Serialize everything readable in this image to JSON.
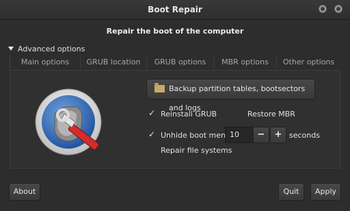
{
  "window": {
    "title": "Boot Repair"
  },
  "heading": "Repair the boot of the computer",
  "advanced": {
    "label": "Advanced options"
  },
  "tabs": [
    {
      "label": "Main options",
      "active": true
    },
    {
      "label": "GRUB location",
      "active": false
    },
    {
      "label": "GRUB options",
      "active": false
    },
    {
      "label": "MBR options",
      "active": false
    },
    {
      "label": "Other options",
      "active": false
    }
  ],
  "main": {
    "backup_button_label": "Backup partition tables, bootsectors and logs",
    "reinstall_grub": {
      "label": "Reinstall GRUB",
      "checked": true
    },
    "restore_mbr": {
      "label": "Restore MBR",
      "checked": false
    },
    "unhide_boot_menu": {
      "label": "Unhide boot menu :",
      "checked": true,
      "value": "10",
      "unit": "seconds"
    },
    "repair_fs": {
      "label": "Repair file systems",
      "checked": false
    }
  },
  "icons": {
    "check": "✓",
    "minus": "−",
    "plus": "+"
  },
  "footer": {
    "about": "About",
    "quit": "Quit",
    "apply": "Apply"
  }
}
